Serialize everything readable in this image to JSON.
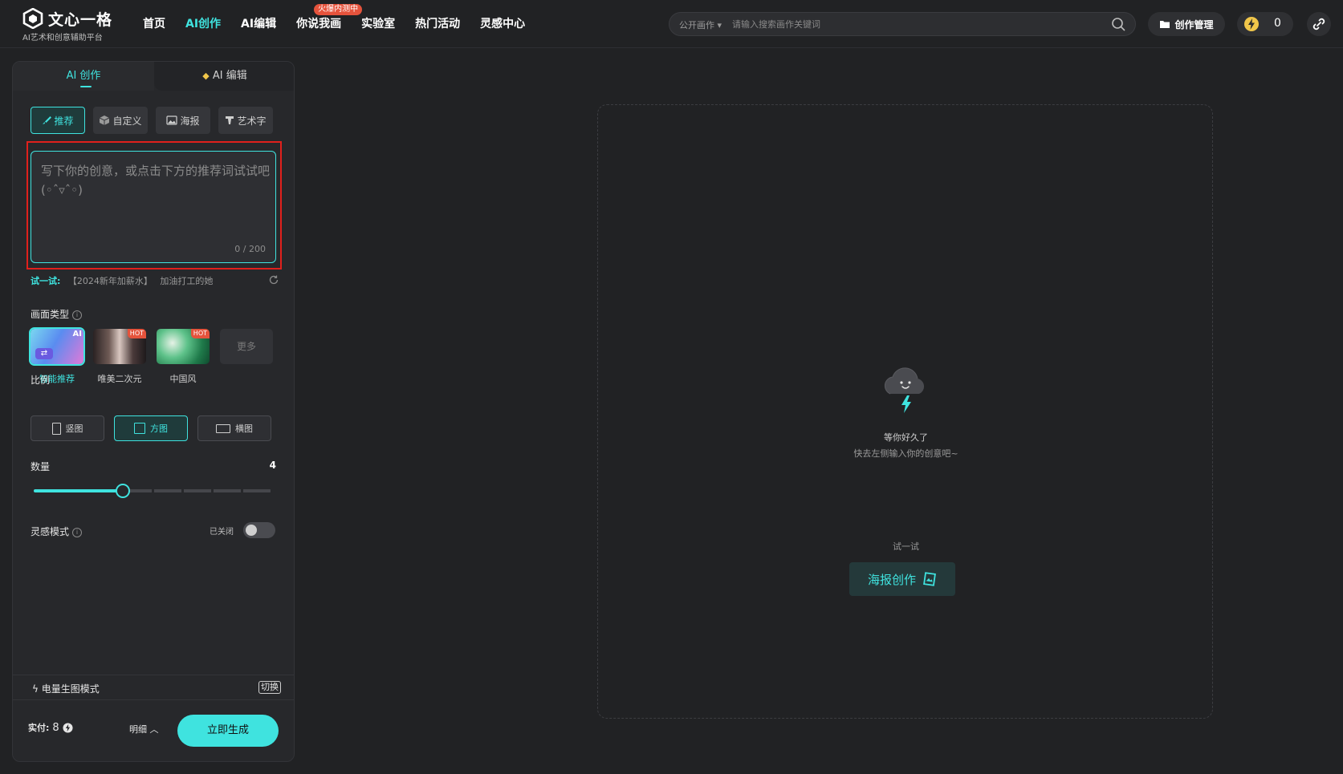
{
  "brand": {
    "title": "文心一格",
    "subtitle": "AI艺术和创意辅助平台"
  },
  "nav": {
    "items": [
      {
        "label": "首页"
      },
      {
        "label": "AI创作"
      },
      {
        "label": "AI编辑"
      },
      {
        "label": "你说我画",
        "badge": "火爆内测中"
      },
      {
        "label": "实验室"
      },
      {
        "label": "热门活动"
      },
      {
        "label": "灵感中心"
      }
    ],
    "active_index": 1
  },
  "search": {
    "scope": "公开画作 ▾",
    "placeholder": "请输入搜索画作关键词"
  },
  "header_actions": {
    "manage_label": "创作管理",
    "credits": "0"
  },
  "panel": {
    "tabs": [
      {
        "label": "AI 创作"
      },
      {
        "label": "AI 编辑"
      }
    ],
    "modes": [
      {
        "label": "推荐",
        "icon": "brush-icon"
      },
      {
        "label": "自定义",
        "icon": "cube-icon"
      },
      {
        "label": "海报",
        "icon": "image-icon"
      },
      {
        "label": "艺术字",
        "icon": "text-icon"
      }
    ],
    "prompt": {
      "placeholder": "写下你的创意，或点击下方的推荐词试试吧(◦ˆ▿ˆ◦)",
      "value": "",
      "counter": "0 / 200"
    },
    "try": {
      "label": "试一试:",
      "chips": [
        "【2024新年加薪水】",
        "加油打工的她"
      ]
    },
    "type_section": {
      "label": "画面类型"
    },
    "types": [
      {
        "name": "智能推荐",
        "badge": "AI"
      },
      {
        "name": "唯美二次元",
        "badge": "HOT"
      },
      {
        "name": "中国风",
        "badge": "HOT"
      }
    ],
    "more_label": "更多",
    "ratio_section": {
      "label": "比例"
    },
    "ratios": [
      {
        "label": "竖图"
      },
      {
        "label": "方图"
      },
      {
        "label": "横图"
      }
    ],
    "count_section": {
      "label": "数量",
      "value": "4",
      "max": 9,
      "current": 4
    },
    "inspiration": {
      "label": "灵感模式",
      "state": "已关闭",
      "enabled": false
    },
    "power_mode": {
      "label": "电量生图模式",
      "switch_label": "切换"
    },
    "footer": {
      "cost_label": "实付:",
      "cost_value": "8",
      "detail_label": "明细 ︿",
      "generate_label": "立即生成"
    }
  },
  "canvas": {
    "empty_title": "等你好久了",
    "empty_subtitle": "快去左侧输入你的创意吧~",
    "try_label": "试一试",
    "poster_button": "海报创作"
  },
  "colors": {
    "accent": "#3fe3df",
    "background": "#212224",
    "panel": "#27282b",
    "badge": "#e5533c"
  }
}
